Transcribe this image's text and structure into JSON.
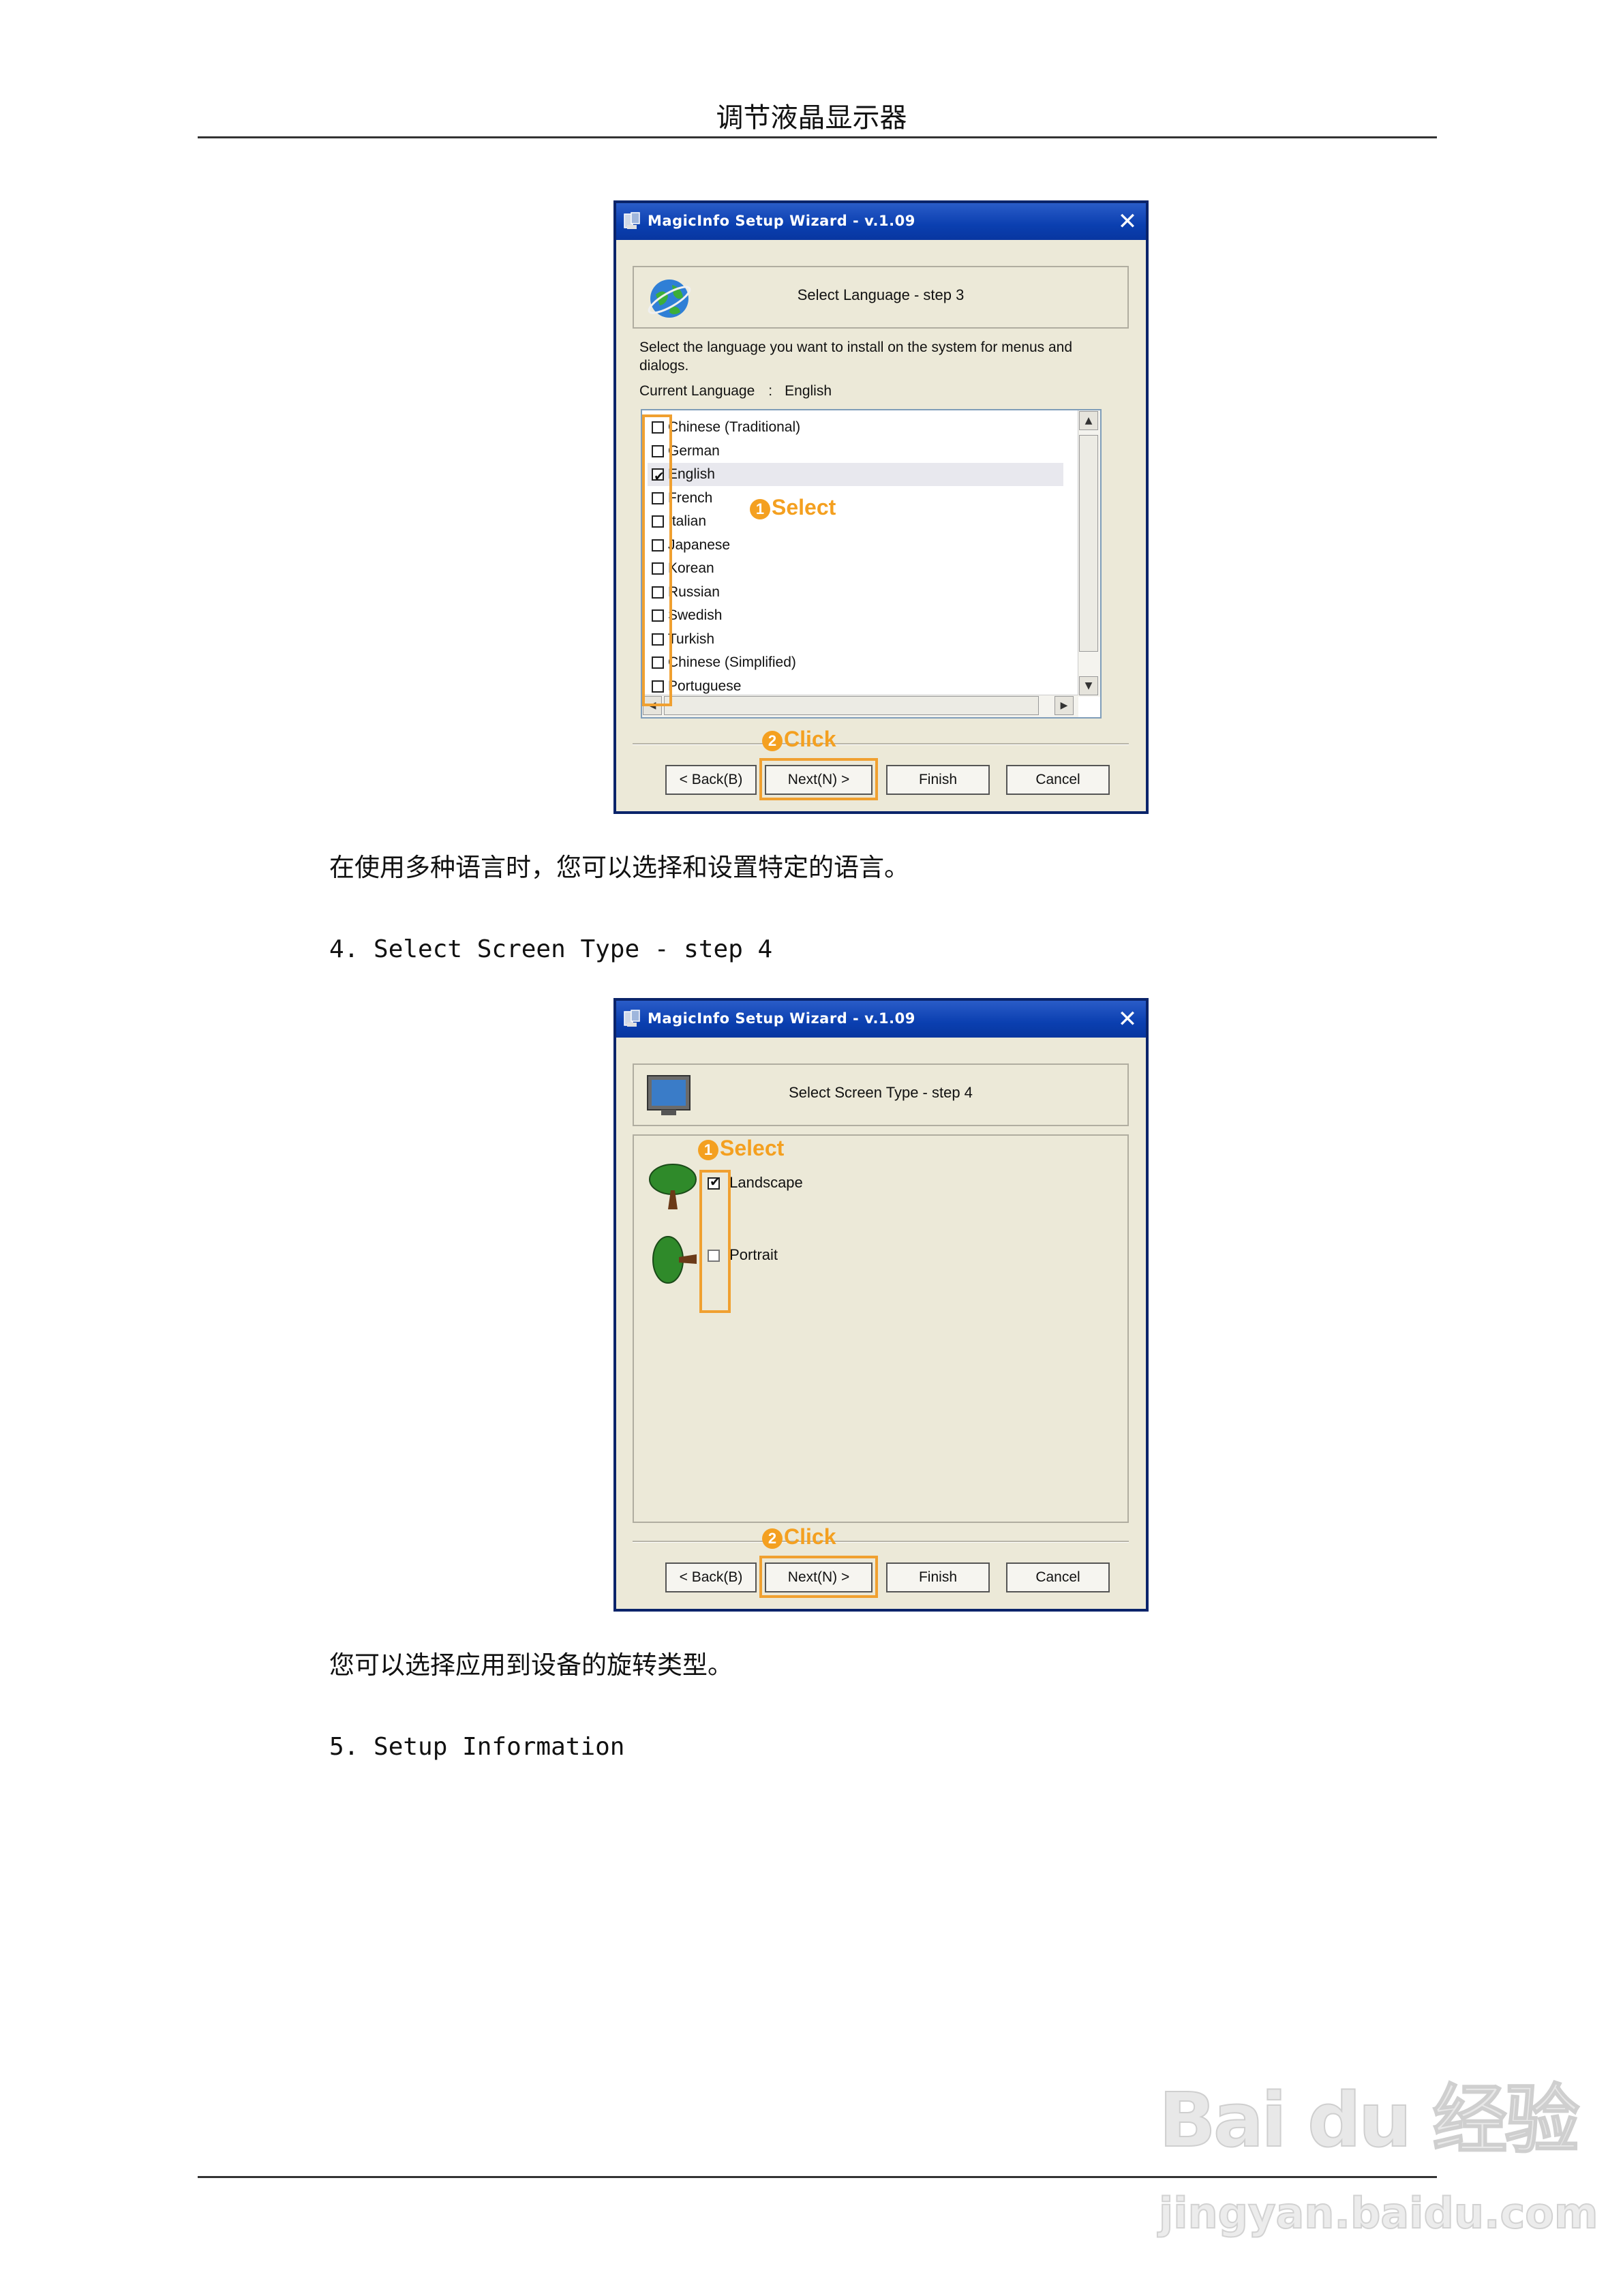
{
  "header": {
    "title": "调节液晶显示器"
  },
  "dialog1": {
    "title": "MagicInfo Setup Wizard - v.1.09",
    "step": "Select Language - step 3",
    "description": "Select the language you want to install on the system for menus and dialogs.",
    "current_language_label": "Current Language",
    "current_language_sep": ":",
    "current_language_value": "English",
    "languages": [
      {
        "label": "Chinese (Traditional)",
        "checked": false
      },
      {
        "label": "German",
        "checked": false
      },
      {
        "label": "English",
        "checked": true
      },
      {
        "label": "French",
        "checked": false
      },
      {
        "label": "Italian",
        "checked": false
      },
      {
        "label": "Japanese",
        "checked": false
      },
      {
        "label": "Korean",
        "checked": false
      },
      {
        "label": "Russian",
        "checked": false
      },
      {
        "label": "Swedish",
        "checked": false
      },
      {
        "label": "Turkish",
        "checked": false
      },
      {
        "label": "Chinese (Simplified)",
        "checked": false
      },
      {
        "label": "Portuguese",
        "checked": false
      }
    ],
    "annotation_select_num": "1",
    "annotation_select": "Select",
    "annotation_click_num": "2",
    "annotation_click": "Click",
    "buttons": {
      "back": "< Back(B)",
      "next": "Next(N) >",
      "finish": "Finish",
      "cancel": "Cancel"
    }
  },
  "caption1": "在使用多种语言时，您可以选择和设置特定的语言。",
  "heading4": "4. Select Screen Type - step 4",
  "dialog2": {
    "title": "MagicInfo Setup Wizard - v.1.09",
    "step": "Select Screen Type - step 4",
    "options": [
      {
        "label": "Landscape",
        "checked": true
      },
      {
        "label": "Portrait",
        "checked": false
      }
    ],
    "annotation_select_num": "1",
    "annotation_select": "Select",
    "annotation_click_num": "2",
    "annotation_click": "Click",
    "buttons": {
      "back": "< Back(B)",
      "next": "Next(N) >",
      "finish": "Finish",
      "cancel": "Cancel"
    }
  },
  "caption2": "您可以选择应用到设备的旋转类型。",
  "heading5": "5. Setup Information",
  "watermark": {
    "line1": "Bai du 经验",
    "line2": "jingyan.baidu.com"
  }
}
